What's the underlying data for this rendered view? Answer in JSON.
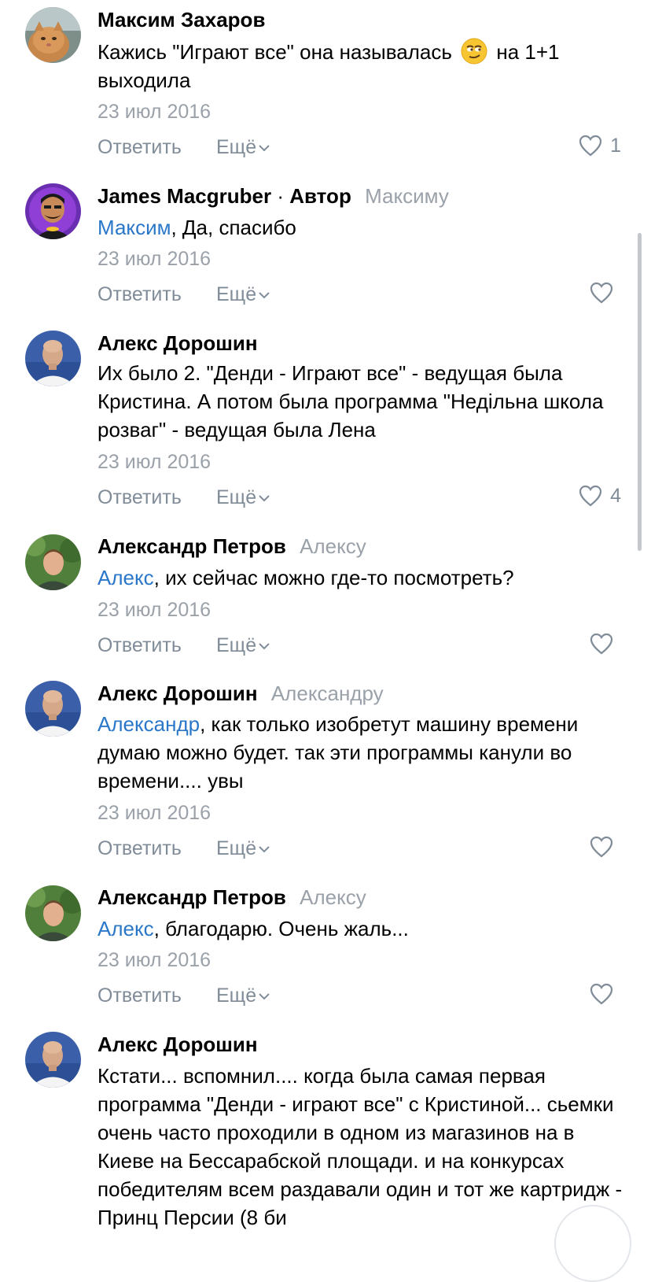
{
  "comments": [
    {
      "author": "Максим Захаров",
      "author_badge": "",
      "reply_to": "",
      "mention": "",
      "text": "Кажись \"Играют все\" она называлась",
      "text_after_emoji": " на 1+1 выходила",
      "emoji": "smirking-face-emoji",
      "date": "23 июл 2016",
      "reply_label": "Ответить",
      "more_label": "Ещё",
      "likes": "1",
      "avatar_icon": "cat-avatar"
    },
    {
      "author": "James Macgruber",
      "author_badge": "Автор",
      "separator": "·",
      "reply_to": "Максиму",
      "mention": "Максим",
      "text": ", Да, спасибо",
      "date": "23 июл 2016",
      "reply_label": "Ответить",
      "more_label": "Ещё",
      "likes": "",
      "avatar_icon": "cartoon-batman-avatar"
    },
    {
      "author": "Алекс Дорошин",
      "author_badge": "",
      "reply_to": "",
      "mention": "",
      "text": "Их было 2. \"Денди - Играют все\" - ведущая была Кристина. А потом была программа \"Недільна школа розваг\" - ведущая была Лена",
      "date": "23 июл 2016",
      "reply_label": "Ответить",
      "more_label": "Ещё",
      "likes": "4",
      "avatar_icon": "bald-man-avatar"
    },
    {
      "author": "Александр Петров",
      "author_badge": "",
      "reply_to": "Алексу",
      "mention": "Алекс",
      "text": ", их сейчас можно где-то посмотреть?",
      "date": "23 июл 2016",
      "reply_label": "Ответить",
      "more_label": "Ещё",
      "likes": "",
      "avatar_icon": "man-outdoors-avatar"
    },
    {
      "author": "Алекс Дорошин",
      "author_badge": "",
      "reply_to": "Александру",
      "mention": "Александр",
      "text": ", как только изобретут машину времени думаю можно будет. так эти программы канули во времени.... увы",
      "date": "23 июл 2016",
      "reply_label": "Ответить",
      "more_label": "Ещё",
      "likes": "",
      "avatar_icon": "bald-man-avatar"
    },
    {
      "author": "Александр Петров",
      "author_badge": "",
      "reply_to": "Алексу",
      "mention": "Алекс",
      "text": ", благодарю. Очень жаль...",
      "date": "23 июл 2016",
      "reply_label": "Ответить",
      "more_label": "Ещё",
      "likes": "",
      "avatar_icon": "man-outdoors-avatar"
    },
    {
      "author": "Алекс Дорошин",
      "author_badge": "",
      "reply_to": "",
      "mention": "",
      "text": "Кстати... вспомнил.... когда была самая первая программа \"Денди - играют все\" с Кристиной... сьемки очень часто проходили в одном из магазинов на в Киеве на Бессарабской площади. и на конкурсах победителям всем раздавали один и тот же картридж - Принц Персии (8 би",
      "date": "",
      "reply_label": "",
      "more_label": "",
      "likes": "",
      "avatar_icon": "bald-man-avatar"
    }
  ],
  "colors": {
    "accent_link": "#2a77c9",
    "secondary_text": "#9aa1a9",
    "action_text": "#818c99"
  }
}
